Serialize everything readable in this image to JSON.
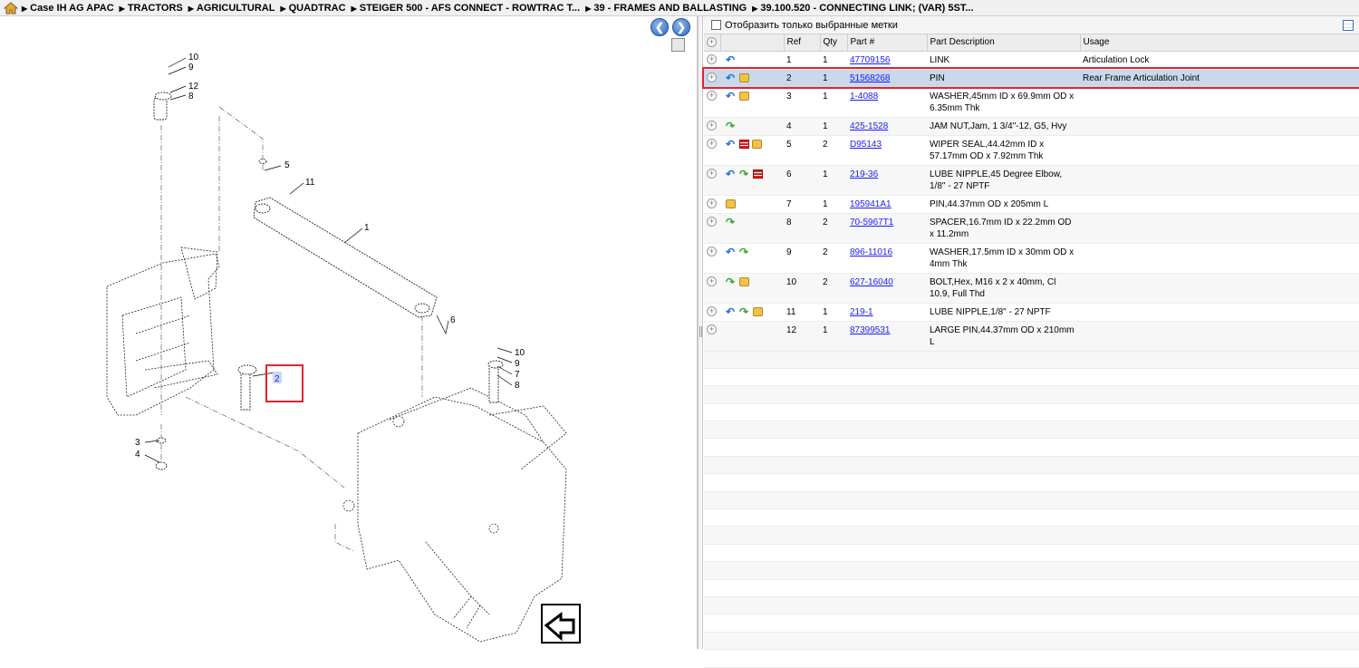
{
  "breadcrumb": {
    "items": [
      "Case IH AG APAC",
      "TRACTORS",
      "AGRICULTURAL",
      "QUADTRAC",
      "STEIGER 500 - AFS CONNECT - ROWTRAC T...",
      "39 - FRAMES AND BALLASTING",
      "39.100.520 - CONNECTING LINK; (VAR) 5ST..."
    ]
  },
  "filter": {
    "label": "Отобразить только выбранные метки"
  },
  "table": {
    "headers": {
      "ref": "Ref",
      "qty": "Qty",
      "part": "Part #",
      "desc": "Part Description",
      "usage": "Usage"
    },
    "rows": [
      {
        "ref": "1",
        "qty": "1",
        "part": "47709156",
        "desc": "LINK",
        "usage": "Articulation Lock",
        "icons": [
          "back"
        ]
      },
      {
        "ref": "2",
        "qty": "1",
        "part": "51568268",
        "desc": "PIN",
        "usage": "Rear Frame Articulation Joint",
        "icons": [
          "back",
          "box"
        ]
      },
      {
        "ref": "3",
        "qty": "1",
        "part": "1-4088",
        "desc": "WASHER,45mm ID x 69.9mm OD x 6.35mm Thk",
        "usage": "",
        "icons": [
          "back",
          "box"
        ]
      },
      {
        "ref": "4",
        "qty": "1",
        "part": "425-1528",
        "desc": "JAM NUT,Jam, 1 3/4\"-12, G5, Hvy",
        "usage": "",
        "icons": [
          "fwd"
        ]
      },
      {
        "ref": "5",
        "qty": "2",
        "part": "D95143",
        "desc": "WIPER SEAL,44.42mm ID x 57.17mm OD x 7.92mm Thk",
        "usage": "",
        "icons": [
          "back",
          "lines",
          "box"
        ]
      },
      {
        "ref": "6",
        "qty": "1",
        "part": "219-36",
        "desc": "LUBE NIPPLE,45 Degree Elbow, 1/8\" - 27 NPTF",
        "usage": "",
        "icons": [
          "back",
          "fwd",
          "lines"
        ]
      },
      {
        "ref": "7",
        "qty": "1",
        "part": "195941A1",
        "desc": "PIN,44.37mm OD x 205mm L",
        "usage": "",
        "icons": [
          "box"
        ]
      },
      {
        "ref": "8",
        "qty": "2",
        "part": "70-5967T1",
        "desc": "SPACER,16.7mm ID x 22.2mm OD x 11.2mm",
        "usage": "",
        "icons": [
          "fwd"
        ]
      },
      {
        "ref": "9",
        "qty": "2",
        "part": "896-11016",
        "desc": "WASHER,17.5mm ID x 30mm OD x 4mm Thk",
        "usage": "",
        "icons": [
          "back",
          "fwd"
        ]
      },
      {
        "ref": "10",
        "qty": "2",
        "part": "627-16040",
        "desc": "BOLT,Hex, M16 x 2 x 40mm, Cl 10.9, Full Thd",
        "usage": "",
        "icons": [
          "fwd",
          "box"
        ]
      },
      {
        "ref": "11",
        "qty": "1",
        "part": "219-1",
        "desc": "LUBE NIPPLE,1/8\" - 27 NPTF",
        "usage": "",
        "icons": [
          "back",
          "fwd",
          "box"
        ]
      },
      {
        "ref": "12",
        "qty": "1",
        "part": "87399531",
        "desc": "LARGE PIN,44.37mm OD x 210mm L",
        "usage": "",
        "icons": []
      }
    ],
    "selected_ref": "2"
  },
  "diagram": {
    "callouts": [
      "10",
      "9",
      "12",
      "8",
      "5",
      "11",
      "1",
      "6",
      "10",
      "9",
      "7",
      "8",
      "2",
      "3",
      "4"
    ],
    "highlighted_callout": "2"
  },
  "colors": {
    "selection_outline": "#e0242c",
    "selected_row": "#c9d9ea",
    "link": "#1a1aff"
  }
}
